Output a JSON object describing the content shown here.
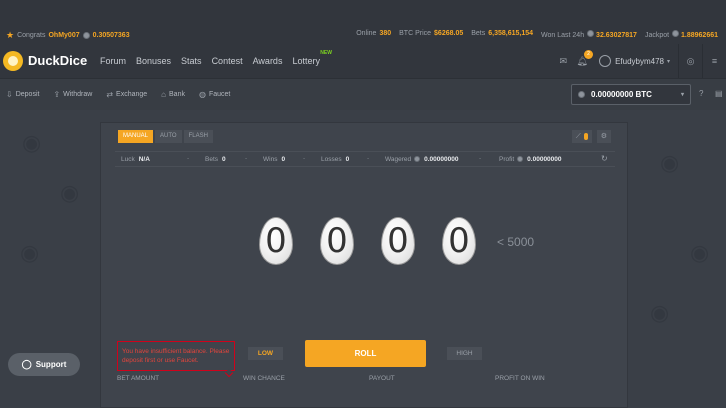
{
  "ticker": {
    "congrats_label": "Congrats",
    "winner": "OhMy007",
    "amount": "0.30507363",
    "online_label": "Online",
    "online": "380",
    "btc_price_label": "BTC Price",
    "btc_price": "$6268.05",
    "bets_label": "Bets",
    "bets": "6,358,615,154",
    "won_label": "Won Last 24h",
    "won": "32.63027817",
    "jackpot_label": "Jackpot",
    "jackpot": "1.88962661"
  },
  "nav": {
    "brand": "DuckDice",
    "menu": [
      "Forum",
      "Bonuses",
      "Stats",
      "Contest",
      "Awards",
      "Lottery"
    ],
    "lottery_badge": "NEW",
    "notifications": "2",
    "username": "Efudybym478"
  },
  "subnav": {
    "items": [
      "Deposit",
      "Withdraw",
      "Exchange",
      "Bank",
      "Faucet"
    ],
    "balance": "0.00000000 BTC"
  },
  "game": {
    "modes": [
      "MANUAL",
      "AUTO",
      "FLASH"
    ],
    "stats": {
      "luck_label": "Luck",
      "luck": "N/A",
      "bets_label": "Bets",
      "bets": "0",
      "wins_label": "Wins",
      "wins": "0",
      "losses_label": "Losses",
      "losses": "0",
      "wagered_label": "Wagered",
      "wagered": "0.00000000",
      "profit_label": "Profit",
      "profit": "0.00000000"
    },
    "digits": [
      "0",
      "0",
      "0",
      "0"
    ],
    "target": "< 5000",
    "error": "You have insufficient balance. Please deposit first or use Faucet.",
    "low_label": "LOW",
    "roll_label": "ROLL",
    "high_label": "HIGH",
    "field_labels": [
      "BET AMOUNT",
      "WIN CHANCE",
      "PAYOUT",
      "PROFIT ON WIN"
    ]
  },
  "support": {
    "label": "Support"
  },
  "colors": {
    "accent": "#f5a623",
    "error": "#d0021b",
    "new_badge": "#7ed321"
  }
}
